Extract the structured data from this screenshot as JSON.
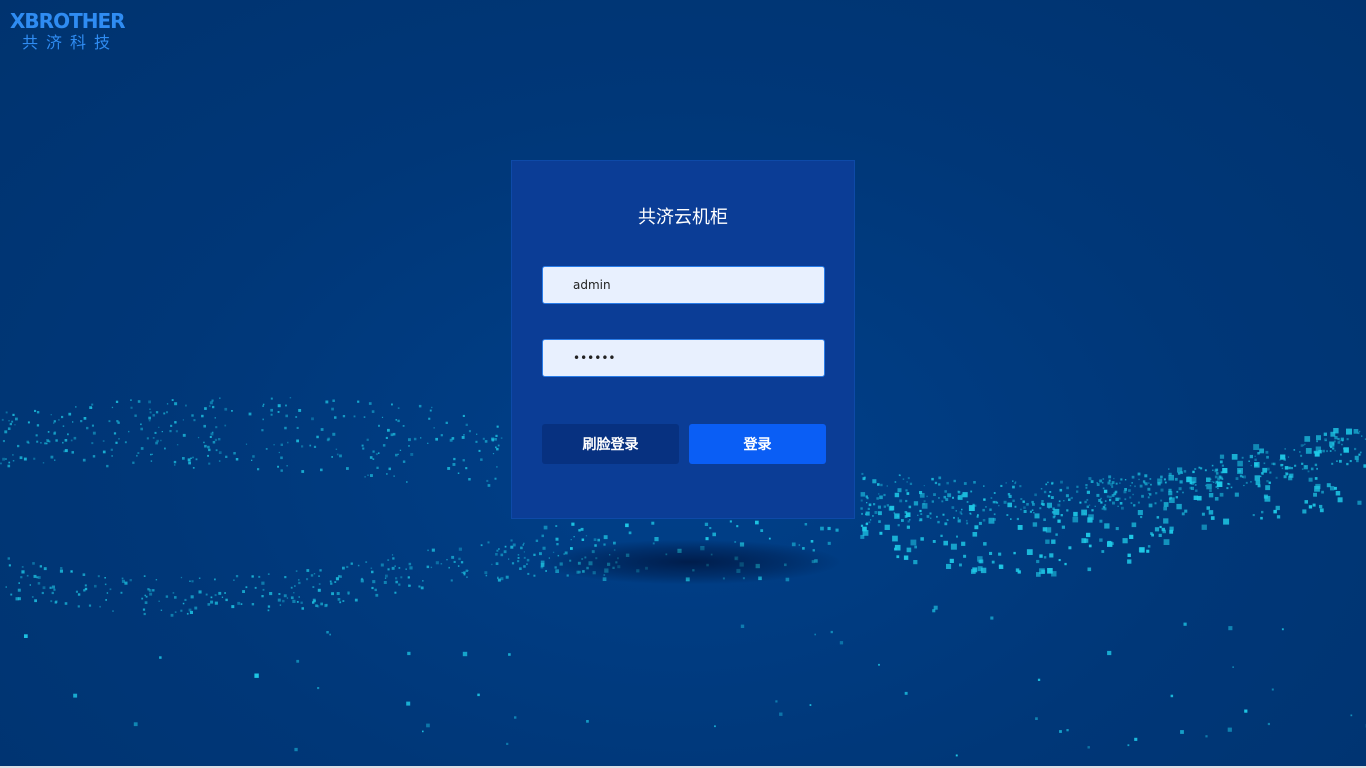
{
  "logo": {
    "brand": "XBROTHER",
    "subtitle": "共济科技"
  },
  "login": {
    "title": "共济云机柜",
    "username_value": "admin",
    "password_value": "••••••",
    "face_login_label": "刷脸登录",
    "login_label": "登录"
  },
  "colors": {
    "background": "#003778",
    "panel": "#0b3d96",
    "particle": "#1ec8e6",
    "primary_button": "#0a5ef5",
    "secondary_button": "#073180",
    "logo": "#2f8cf2"
  }
}
